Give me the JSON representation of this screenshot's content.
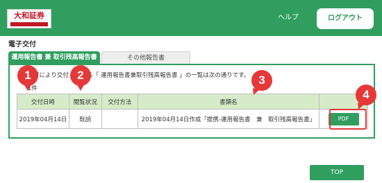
{
  "header": {
    "logo_text": "大和証券",
    "logo_subtext": "Daiwa Securities",
    "help_label": "ヘルプ",
    "logout_label": "ログアウト"
  },
  "page": {
    "title": "電子交付"
  },
  "tabs": [
    {
      "label": "運用報告書 兼 取引残高報告書",
      "active": true
    },
    {
      "label": "その他報告書",
      "active": false
    }
  ],
  "content": {
    "intro_text": "付により交付",
    "intro_text_2": "いる「 運用報告書兼取引残高報告書 」の一覧は次の通りです。",
    "count_text": "1件"
  },
  "table": {
    "headers": [
      "交付日時",
      "閲覧状況",
      "交付方法",
      "書類名",
      ""
    ],
    "rows": [
      {
        "date": "2019年04月14日",
        "status": "既読",
        "method": "",
        "name": "2019年04月14日作成「提携-運用報告書　兼　取引残高報告書」",
        "pdf_label": "PDF"
      }
    ]
  },
  "callouts": [
    "1",
    "2",
    "3",
    "4"
  ],
  "footer": {
    "top_label": "TOP"
  },
  "colors": {
    "brand_green": "#2f9e5f",
    "header_row": "#d6ecc8",
    "callout_red": "#e53838",
    "logo_red": "#c01828"
  }
}
